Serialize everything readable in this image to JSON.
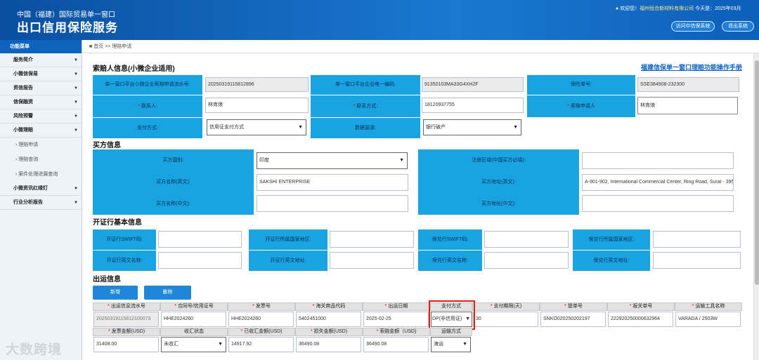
{
  "header": {
    "subtitle": "中国（福建）国际贸易单一窗口",
    "title": "出口信用保险服务",
    "welcome": "欢迎您！",
    "company": "福州恒合新材料有限公司",
    "date": "今天是：2025年03月",
    "btn_portal": "访问中信保系统",
    "btn_exit": "退出系统"
  },
  "sidebar": {
    "title": "功能菜单",
    "items": [
      "服务简介",
      "小微信保易",
      "资信报告",
      "信保融资",
      "风险预警",
      "小微理赔"
    ],
    "sub": [
      "理赔申请",
      "理赔查询",
      "案件处理进展查询"
    ],
    "items2": [
      "小微资讯红绿灯",
      "行业分析报告"
    ],
    "arrow": "▼"
  },
  "breadcrumb": {
    "home": "首页",
    "sep": ">>",
    "current": "理赔申请"
  },
  "claimant": {
    "section": "索赔人信息(小微企业适用)",
    "manual_link": "福建信保单一窗口理赔功能操作手册",
    "serial_label": "单一窗口平台小微企业索赔申请流水号:",
    "serial": "20250319115812896",
    "uscc_label": "单一窗口平台企业唯一编码:",
    "uscc": "91350103MA33G4XH2F",
    "policy_label": "保险单号:",
    "policy": "SSE384908-232300",
    "contact_label": "联系人:",
    "contact": "林育烺",
    "phone_label": "联系方式:",
    "phone": "18120937755",
    "applicant_label": "索赔申请人",
    "applicant": "林育烺",
    "payment_label": "支付方式:",
    "payment": "信用证支付方式",
    "source_label": "数据源源:",
    "source": "银行破产"
  },
  "buyer": {
    "section": "买方信息",
    "country_label": "买方国别:",
    "country": "印度",
    "region_label": "注册区域(中国买方必填):",
    "region": "",
    "name_en_label": "买方名称(英文):",
    "name_en": "SAKSHI ENTERPRISE",
    "addr_en_label": "买方地址(英文):",
    "addr_en": "A-901-902, International Commercial Center, Ring Road, Surat - 39500",
    "name_cn_label": "买方名称(中文):",
    "name_cn": "",
    "addr_cn_label": "买方地址(中文):",
    "addr_cn": ""
  },
  "bank": {
    "section": "开证行基本信息",
    "l1": "开证行SWIFT码:",
    "l2": "开证行所属国家地区:",
    "l3": "保兑行SWIFT码:",
    "l4": "保兑行所属国家地区:",
    "l5": "开证行英文名称:",
    "l6": "开证行英文地址:",
    "l7": "保兑行英文名称:",
    "l8": "保兑行英文地址:"
  },
  "shipment": {
    "section": "出运信息",
    "btn_add": "新增",
    "btn_delete": "删除",
    "headers": [
      "出运信息流水号",
      "合同号/信用证号",
      "发票号",
      "海关商品代码",
      "出运日期",
      "支付方式",
      "支付期限(天)",
      "提单号",
      "报关单号",
      "运输工具名称"
    ],
    "row": [
      "20250319115812100073",
      "HHE2024260",
      "HHE2024260",
      "5402451000",
      "2025-02-25",
      "DP(非信用证)",
      "30",
      "SNKO020250202197",
      "222920250000632964",
      "VARADA / 2503W"
    ],
    "headers2": [
      "发票金额(USD)",
      "收汇状态",
      "已收汇金额(USD)",
      "损失金额(USD)",
      "索赔金额（USD)",
      "运输方式"
    ],
    "row2": [
      "31408.00",
      "未收汇",
      "14917.92",
      "36490.08",
      "36490.08",
      "海运"
    ]
  },
  "watermark": "大数跨境"
}
